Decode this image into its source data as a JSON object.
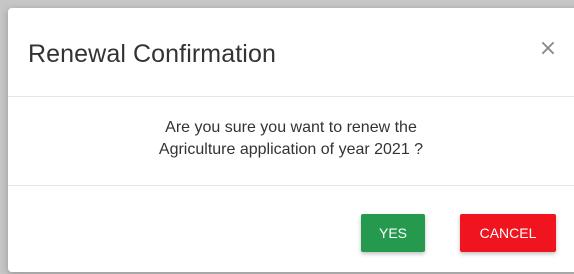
{
  "dialog": {
    "title": "Renewal Confirmation",
    "close_icon": "close-icon",
    "message_line1": "Are you sure you want to renew the",
    "message_line2": "Agriculture application of year 2021 ?",
    "yes_label": "YES",
    "cancel_label": "CANCEL"
  },
  "colors": {
    "yes_button": "#259a4f",
    "cancel_button": "#f0141e",
    "title_text": "#333333"
  }
}
